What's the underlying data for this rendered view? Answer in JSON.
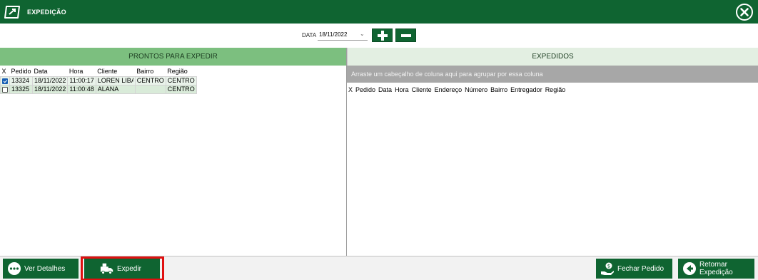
{
  "window": {
    "title": "EXPEDIÇÃO"
  },
  "icons": {
    "logo": "app-logo-icon",
    "close": "close-icon",
    "plus": "plus-icon",
    "minus": "minus-icon",
    "details": "more-dots-icon",
    "dispatch": "dispatch-truck-icon",
    "close_order": "hand-money-icon",
    "return": "arrow-left-icon"
  },
  "colors": {
    "brand_green": "#0f6431",
    "header_green": "#7cbf7f",
    "light_green": "#e3efe2",
    "highlight_red": "#e01010"
  },
  "toolbar": {
    "date_label": "DATA",
    "date_value": "18/11/2022"
  },
  "left_panel": {
    "title": "PRONTOS PARA EXPEDIR",
    "columns": [
      "X",
      "Pedido",
      "Data",
      "Hora",
      "Cliente",
      "Bairro",
      "Região"
    ],
    "rows": [
      {
        "checked": true,
        "pedido": "13324",
        "data": "18/11/2022",
        "hora": "11:00:17",
        "cliente": "LOREN LIBA",
        "bairro": "CENTRO",
        "regiao": "CENTRO"
      },
      {
        "checked": false,
        "pedido": "13325",
        "data": "18/11/2022",
        "hora": "11:00:48",
        "cliente": "ALANA",
        "bairro": "",
        "regiao": "CENTRO"
      }
    ]
  },
  "right_panel": {
    "title": "EXPEDIDOS",
    "group_hint": "Arraste um cabeçalho de coluna aqui para agrupar por essa coluna",
    "columns": [
      "X",
      "Pedido",
      "Data",
      "Hora",
      "Cliente",
      "Endereço",
      "Número",
      "Bairro",
      "Entregador",
      "Região"
    ]
  },
  "footer": {
    "details_label": "Ver Detalhes",
    "dispatch_label": "Expedir",
    "close_order_label": "Fechar Pedido",
    "return_label_1": "Retornar",
    "return_label_2": "Expedição"
  }
}
